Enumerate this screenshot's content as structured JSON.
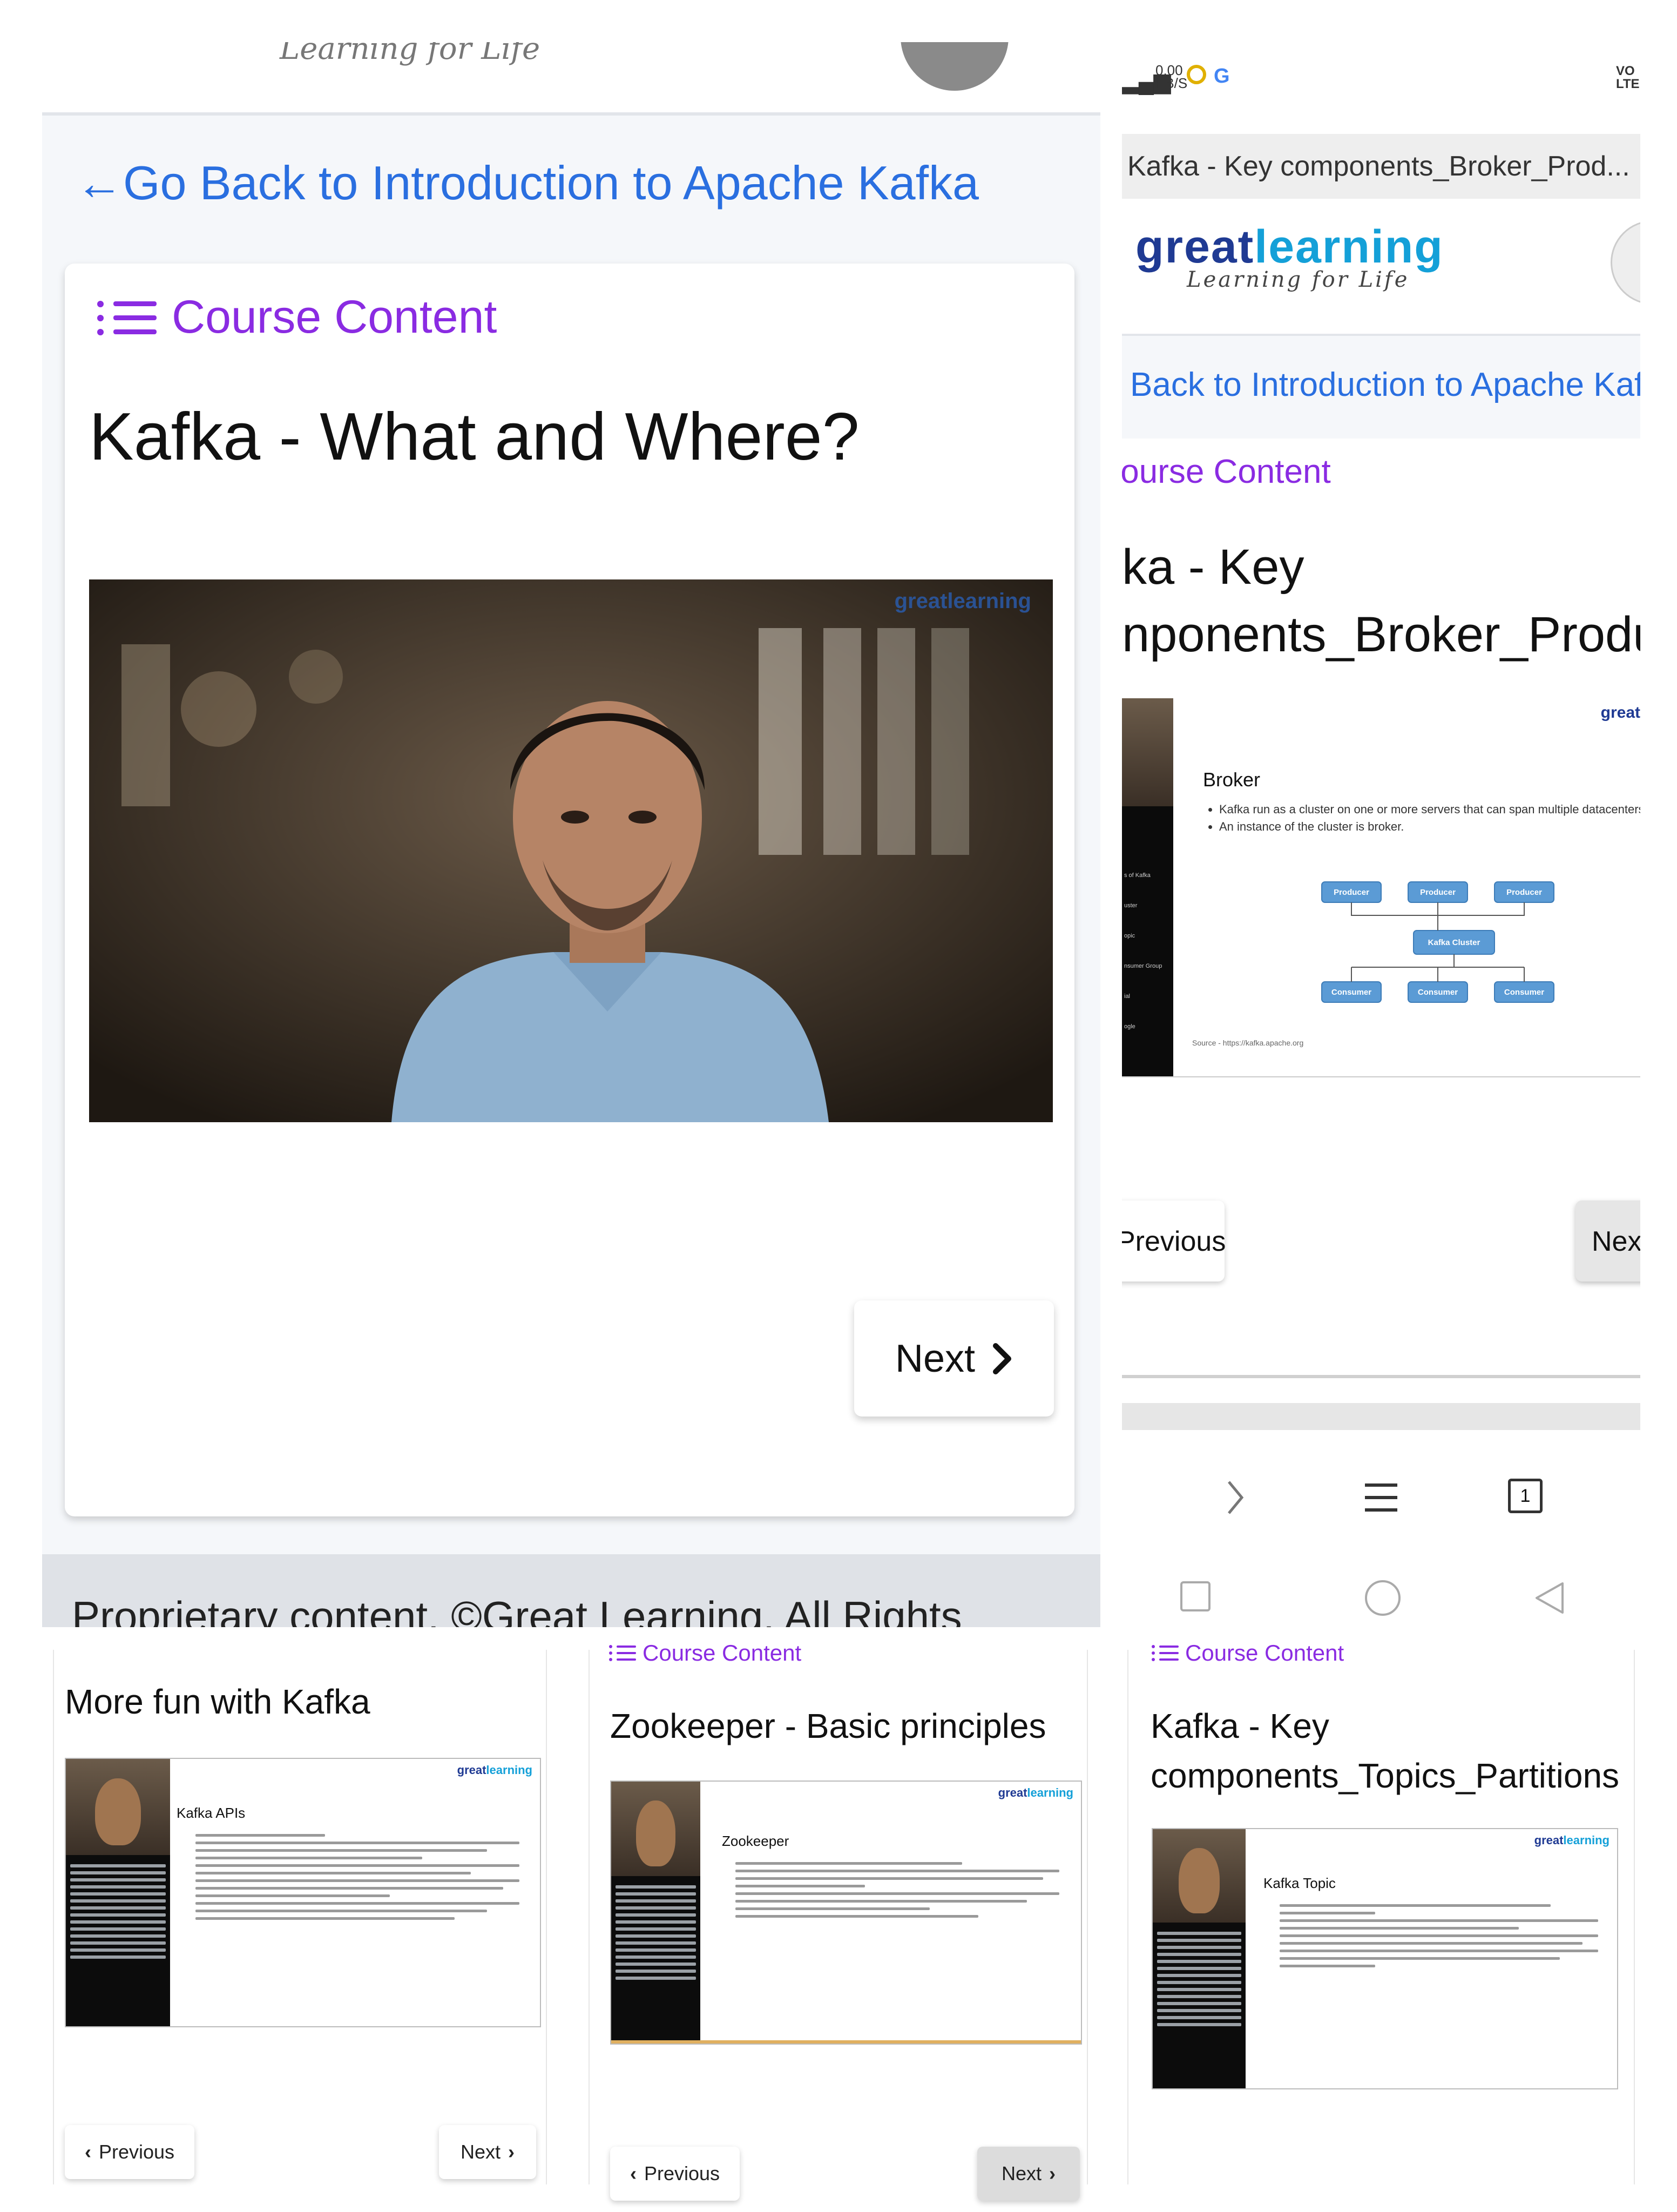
{
  "panel1": {
    "tagline": "Learning for Life",
    "back_arrow": "←",
    "back_link": "Go Back to Introduction to Apache Kafka",
    "course_content": "Course Content",
    "lesson_title": "Kafka - What and Where?",
    "video_watermark": "greatlearning",
    "next_label": "Next",
    "footer_text": "Proprietary content. ©Great Learning. All Rights"
  },
  "panel2": {
    "status": {
      "net": "0.00",
      "net_unit": "KB/S",
      "app": "G",
      "volte": "VO LTE"
    },
    "tab_title": "Kafka - Key components_Broker_Prod...",
    "logo_main_1": "great",
    "logo_main_2": "learning",
    "logo_sub": "Learning for Life",
    "back_link": "Back to Introduction to Apache Kafl",
    "course_content": ":ourse Content",
    "title_line1": "ka - Key",
    "title_line2": "nponents_Broker_Produ",
    "slide": {
      "logo": "great",
      "heading": "Broker",
      "bullets": [
        "Kafka run as a cluster on one or more servers that can span multiple datacenters.",
        "An instance of the cluster is broker."
      ],
      "producers": [
        "Producer",
        "Producer",
        "Producer"
      ],
      "cluster": "Kafka Cluster",
      "consumers": [
        "Consumer",
        "Consumer",
        "Consumer"
      ],
      "source": "Source - https://kafka.apache.org",
      "sidebar_items": [
        "s of Kafka",
        "uster",
        "opic",
        "nsumer Group",
        "ial",
        "ogle"
      ]
    },
    "previous_label": "Previous",
    "next_label": "Nex",
    "tab_count": "1"
  },
  "panel3": {
    "title": "More fun with Kafka",
    "slide_logo_1": "great",
    "slide_logo_2": "learning",
    "slide_heading": "Kafka APIs",
    "previous_label": "Previous",
    "next_label": "Next"
  },
  "panel4": {
    "course_content": "Course Content",
    "title": "Zookeeper - Basic principles",
    "slide_logo_1": "great",
    "slide_logo_2": "learning",
    "slide_heading": "Zookeeper",
    "previous_label": "Previous",
    "next_label": "Next"
  },
  "panel5": {
    "course_content": "Course Content",
    "title_line1": "Kafka - Key",
    "title_line2": "components_Topics_Partitions",
    "slide_logo_1": "great",
    "slide_logo_2": "learning",
    "slide_heading": "Kafka Topic"
  }
}
